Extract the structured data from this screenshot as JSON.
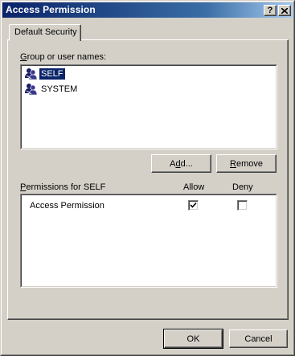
{
  "window": {
    "title": "Access Permission",
    "help_button": "?",
    "close_button": "✕"
  },
  "tabs": [
    {
      "label": "Default Security",
      "selected": true
    }
  ],
  "group_section": {
    "label_mnemonic": "G",
    "label_rest": "roup or user names:",
    "users": [
      {
        "name": "SELF",
        "icon": "user-group-icon",
        "selected": true
      },
      {
        "name": "SYSTEM",
        "icon": "user-group-icon",
        "selected": false
      }
    ]
  },
  "buttons": {
    "add_pre": "A",
    "add_mnemonic": "d",
    "add_post": "d...",
    "remove_mnemonic": "R",
    "remove_rest": "emove",
    "ok": "OK",
    "cancel": "Cancel"
  },
  "permissions": {
    "label_mnemonic": "P",
    "label_rest": "ermissions for SELF",
    "allow_header": "Allow",
    "deny_header": "Deny",
    "rows": [
      {
        "name": "Access Permission",
        "allow": true,
        "deny": false
      }
    ]
  },
  "colors": {
    "titlebar_start": "#0a246a",
    "titlebar_end": "#a6caf0",
    "selection": "#0a246a",
    "face": "#d4d0c8"
  }
}
